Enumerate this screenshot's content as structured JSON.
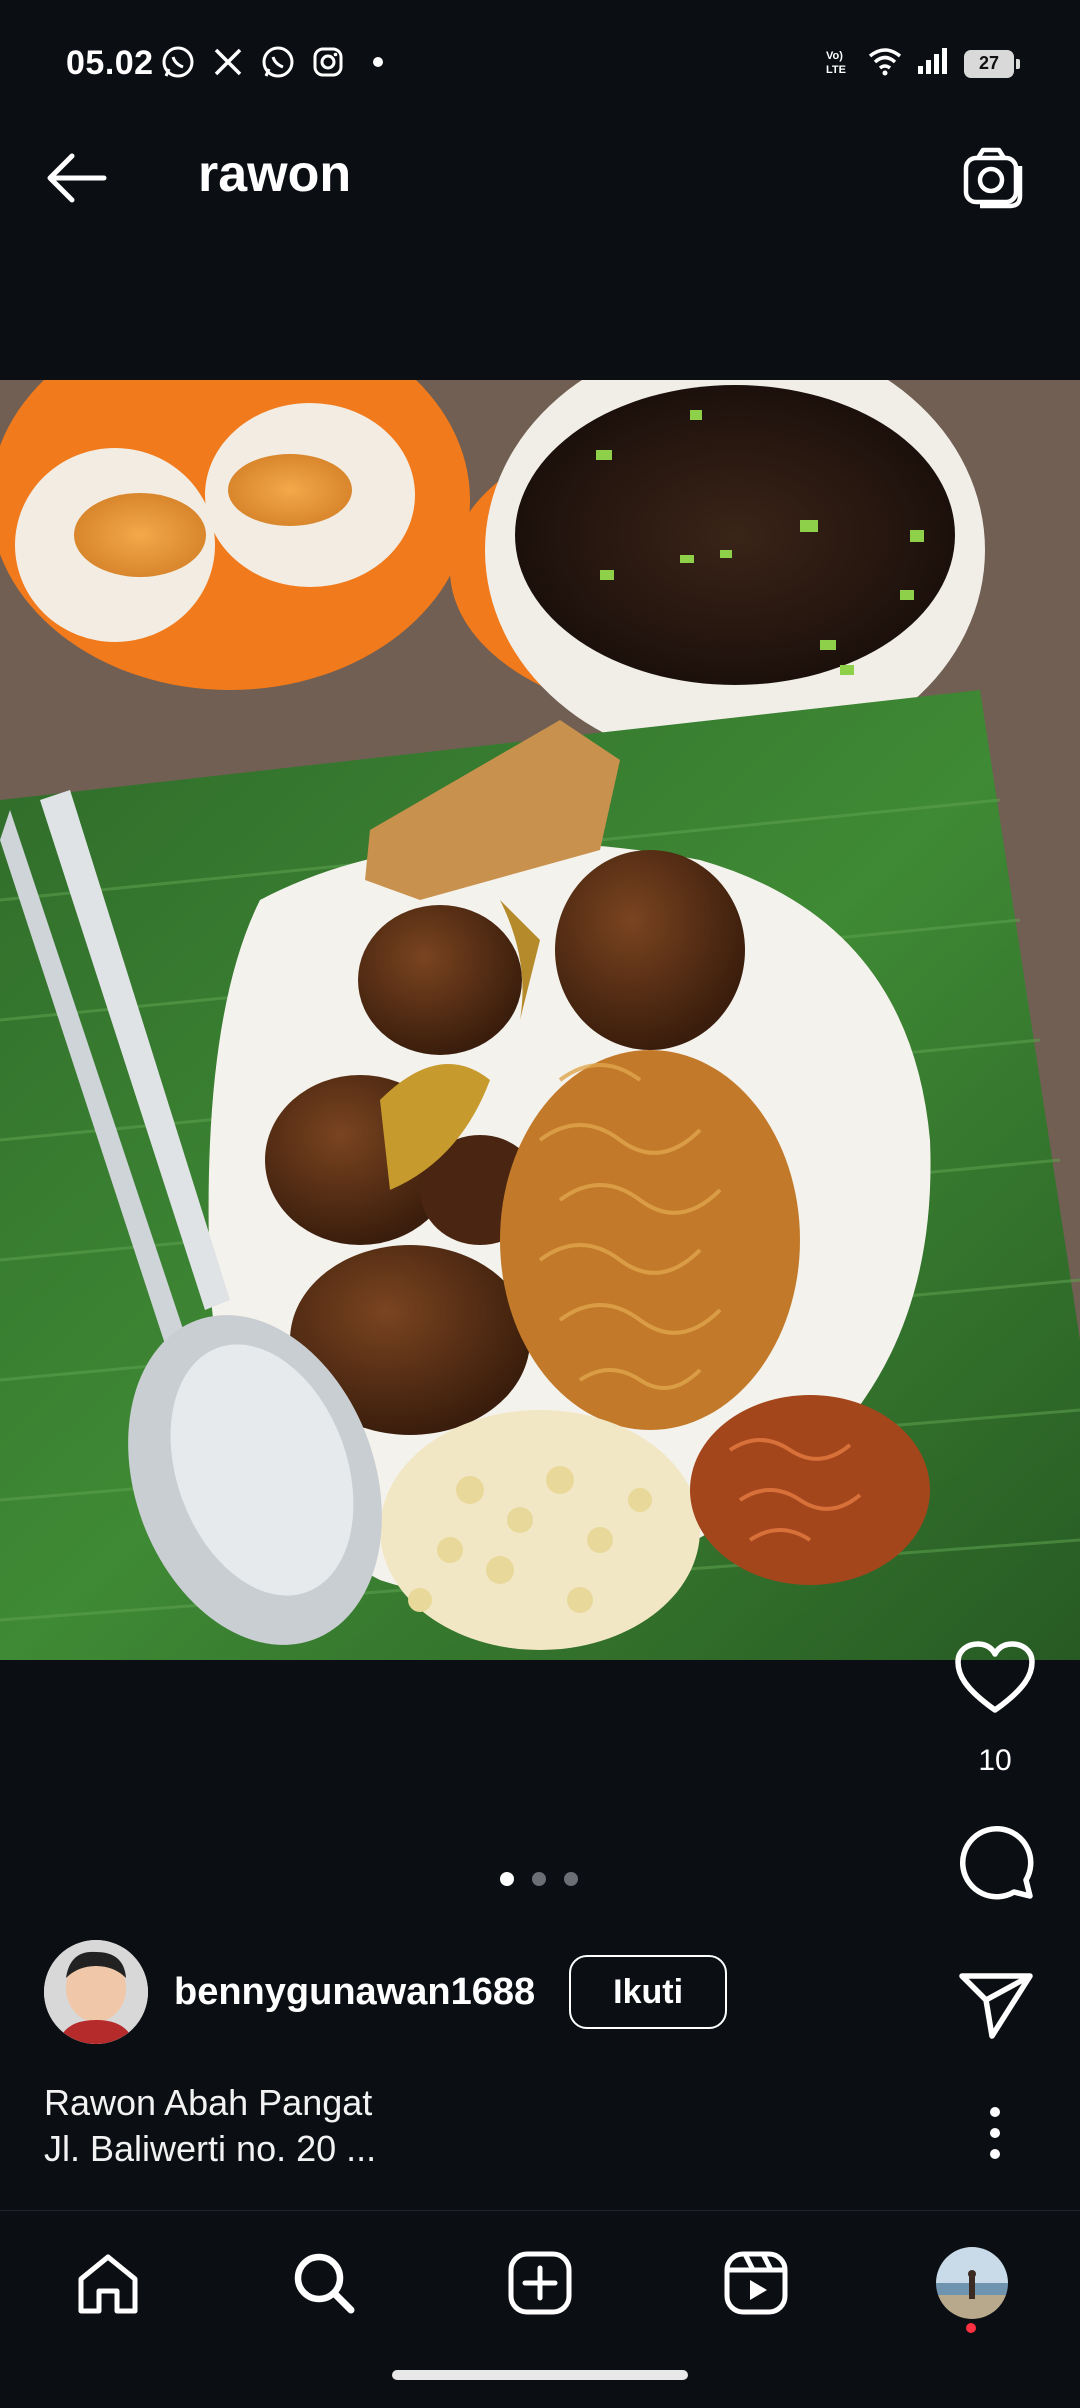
{
  "status_bar": {
    "time": "05.02",
    "battery": "27",
    "apps": [
      "whatsapp-icon",
      "x-icon",
      "whatsapp-icon",
      "instagram-icon",
      "notification-dot-icon"
    ],
    "indicators": [
      "volte-icon",
      "wifi-icon",
      "signal-icon",
      "battery-icon"
    ]
  },
  "header": {
    "title": "rawon"
  },
  "post": {
    "likes": "10",
    "carousel": {
      "count": 3,
      "active": 0
    },
    "author": {
      "username": "bennygunawan1688",
      "follow_label": "Ikuti"
    },
    "caption": {
      "line1": "Rawon Abah Pangat",
      "line2": "Jl. Baliwerti no. 20 ..."
    }
  },
  "bottom_nav": {
    "items": [
      "home-icon",
      "search-icon",
      "create-post-icon",
      "reels-icon",
      "profile-avatar"
    ],
    "active": "search-icon"
  },
  "colors": {
    "background": "#0b0f14",
    "text": "#ffffff",
    "notification": "#ff3040"
  }
}
